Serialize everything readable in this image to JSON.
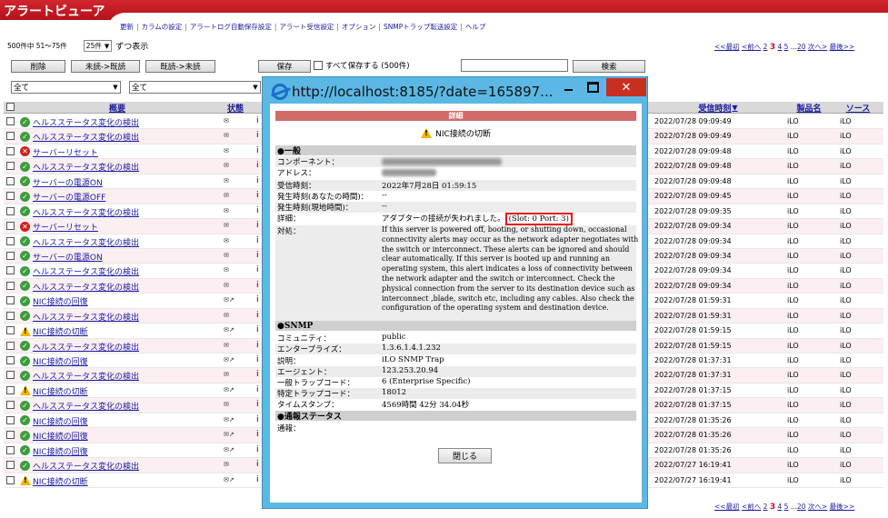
{
  "app": {
    "title": "アラートビューア"
  },
  "menu": [
    "更新",
    "カラムの設定",
    "アラートログ自動保存設定",
    "アラート受信設定",
    "オプション",
    "SNMPトラップ転送設定",
    "ヘルプ"
  ],
  "toolbar": {
    "range_text": "500件中 51～75件",
    "per_page": "25件",
    "per_page_suffix": "ずつ表示",
    "delete": "削除",
    "unread_to_read": "未読->既読",
    "read_to_unread": "既読->未読",
    "save": "保存",
    "save_all": "すべて保存する (500件)",
    "search": "検索",
    "filter1": "全て",
    "filter2": "全て"
  },
  "pager": {
    "first": "<<最初",
    "prev": "<前へ",
    "pages": [
      "2",
      "3",
      "4",
      "5"
    ],
    "current": "3",
    "ellipsis": "...",
    "last_page": "20",
    "next": "次へ>",
    "last": "最後>>"
  },
  "columns": {
    "summary": "概要",
    "status": "状態",
    "received": "受信時刻",
    "product": "製品名",
    "source": "ソース"
  },
  "rows": [
    {
      "icon": "ok",
      "summary": "ヘルスステータス変化の検出",
      "received": "2022/07/28 09:09:49",
      "product": "iLO",
      "source": "iLO"
    },
    {
      "icon": "ok",
      "summary": "ヘルスステータス変化の検出",
      "received": "2022/07/28 09:09:49",
      "product": "iLO",
      "source": "iLO"
    },
    {
      "icon": "err",
      "summary": "サーバーリセット",
      "received": "2022/07/28 09:09:48",
      "product": "iLO",
      "source": "iLO"
    },
    {
      "icon": "ok",
      "summary": "ヘルスステータス変化の検出",
      "received": "2022/07/28 09:09:48",
      "product": "iLO",
      "source": "iLO"
    },
    {
      "icon": "ok",
      "summary": "サーバーの電源ON",
      "received": "2022/07/28 09:09:48",
      "product": "iLO",
      "source": "iLO"
    },
    {
      "icon": "ok",
      "summary": "サーバーの電源OFF",
      "received": "2022/07/28 09:09:45",
      "product": "iLO",
      "source": "iLO"
    },
    {
      "icon": "ok",
      "summary": "ヘルスステータス変化の検出",
      "received": "2022/07/28 09:09:35",
      "product": "iLO",
      "source": "iLO"
    },
    {
      "icon": "err",
      "summary": "サーバーリセット",
      "received": "2022/07/28 09:09:34",
      "product": "iLO",
      "source": "iLO"
    },
    {
      "icon": "ok",
      "summary": "ヘルスステータス変化の検出",
      "received": "2022/07/28 09:09:34",
      "product": "iLO",
      "source": "iLO"
    },
    {
      "icon": "ok",
      "summary": "サーバーの電源ON",
      "received": "2022/07/28 09:09:34",
      "product": "iLO",
      "source": "iLO"
    },
    {
      "icon": "ok",
      "summary": "ヘルスステータス変化の検出",
      "received": "2022/07/28 09:09:34",
      "product": "iLO",
      "source": "iLO"
    },
    {
      "icon": "ok",
      "summary": "ヘルスステータス変化の検出",
      "received": "2022/07/28 09:09:34",
      "product": "iLO",
      "source": "iLO"
    },
    {
      "icon": "ok",
      "summary": "NIC接続の回復",
      "received": "2022/07/28 01:59:31",
      "product": "iLO",
      "source": "iLO"
    },
    {
      "icon": "ok",
      "summary": "ヘルスステータス変化の検出",
      "received": "2022/07/28 01:59:31",
      "product": "iLO",
      "source": "iLO"
    },
    {
      "icon": "warn",
      "summary": "NIC接続の切断",
      "received": "2022/07/28 01:59:15",
      "product": "iLO",
      "source": "iLO"
    },
    {
      "icon": "ok",
      "summary": "ヘルスステータス変化の検出",
      "received": "2022/07/28 01:59:15",
      "product": "iLO",
      "source": "iLO"
    },
    {
      "icon": "ok",
      "summary": "NIC接続の回復",
      "received": "2022/07/28 01:37:31",
      "product": "iLO",
      "source": "iLO"
    },
    {
      "icon": "ok",
      "summary": "ヘルスステータス変化の検出",
      "received": "2022/07/28 01:37:31",
      "product": "iLO",
      "source": "iLO"
    },
    {
      "icon": "warn",
      "summary": "NIC接続の切断",
      "received": "2022/07/28 01:37:15",
      "product": "iLO",
      "source": "iLO"
    },
    {
      "icon": "ok",
      "summary": "ヘルスステータス変化の検出",
      "received": "2022/07/28 01:37:15",
      "product": "iLO",
      "source": "iLO"
    },
    {
      "icon": "ok",
      "summary": "NIC接続の回復",
      "received": "2022/07/28 01:35:26",
      "product": "iLO",
      "source": "iLO"
    },
    {
      "icon": "ok",
      "summary": "NIC接続の回復",
      "received": "2022/07/28 01:35:26",
      "product": "iLO",
      "source": "iLO"
    },
    {
      "icon": "ok",
      "summary": "NIC接続の回復",
      "received": "2022/07/28 01:35:26",
      "product": "iLO",
      "source": "iLO"
    },
    {
      "icon": "ok",
      "summary": "ヘルスステータス変化の検出",
      "received": "2022/07/27 16:19:41",
      "product": "iLO",
      "source": "iLO"
    },
    {
      "icon": "warn",
      "summary": "NIC接続の切断",
      "received": "2022/07/27 16:19:41",
      "product": "iLO",
      "source": "iLO"
    }
  ],
  "popup": {
    "url": "http://localhost:8185/?date=165897...",
    "header": "詳細",
    "subject": "NIC接続の切断",
    "sections": {
      "general": "●一般",
      "snmp": "●SNMP",
      "notify": "●通報ステータス"
    },
    "general": {
      "component_k": "コンポーネント：",
      "address_k": "アドレス：",
      "received_k": "受信時刻：",
      "received_v": "2022年7月28日 01:59:15",
      "local_k": "発生時刻(あなたの時間)：",
      "local_v": "--",
      "site_k": "発生時刻(現地時間)：",
      "site_v": "--",
      "detail_k": "詳細：",
      "detail_v": "アダプターの接続が失われました。",
      "detail_hl": "(Slot: 0 Port: 3)",
      "action_k": "対処：",
      "action_v": "If this server is powered off, booting, or shutting down, occasional connectivity alerts may occur as the network adapter negotiates with the switch or interconnect. These alerts can be ignored and should clear automatically. If this server is booted up and running an operating system, this alert indicates a loss of connectivity between the network adapter and the switch or interconnect. Check the physical connection from the server to its destination device such as interconnect ,blade, switch etc, including any cables. Also check the configuration of the operating system and destination device."
    },
    "snmp": {
      "community_k": "コミュニティ：",
      "community_v": "public",
      "enterprise_k": "エンタープライズ：",
      "enterprise_v": "1.3.6.1.4.1.232",
      "desc_k": "説明：",
      "desc_v": "iLO SNMP Trap",
      "agent_k": "エージェント：",
      "agent_v": "123.253.20.94",
      "generic_k": "一般トラップコード：",
      "generic_v": "6 (Enterprise Specific)",
      "specific_k": "特定トラップコード：",
      "specific_v": "18012",
      "timestamp_k": "タイムスタンプ：",
      "timestamp_v": "4569時間 42分 34.04秒"
    },
    "notify": {
      "report_k": "通報："
    },
    "close": "閉じる"
  }
}
